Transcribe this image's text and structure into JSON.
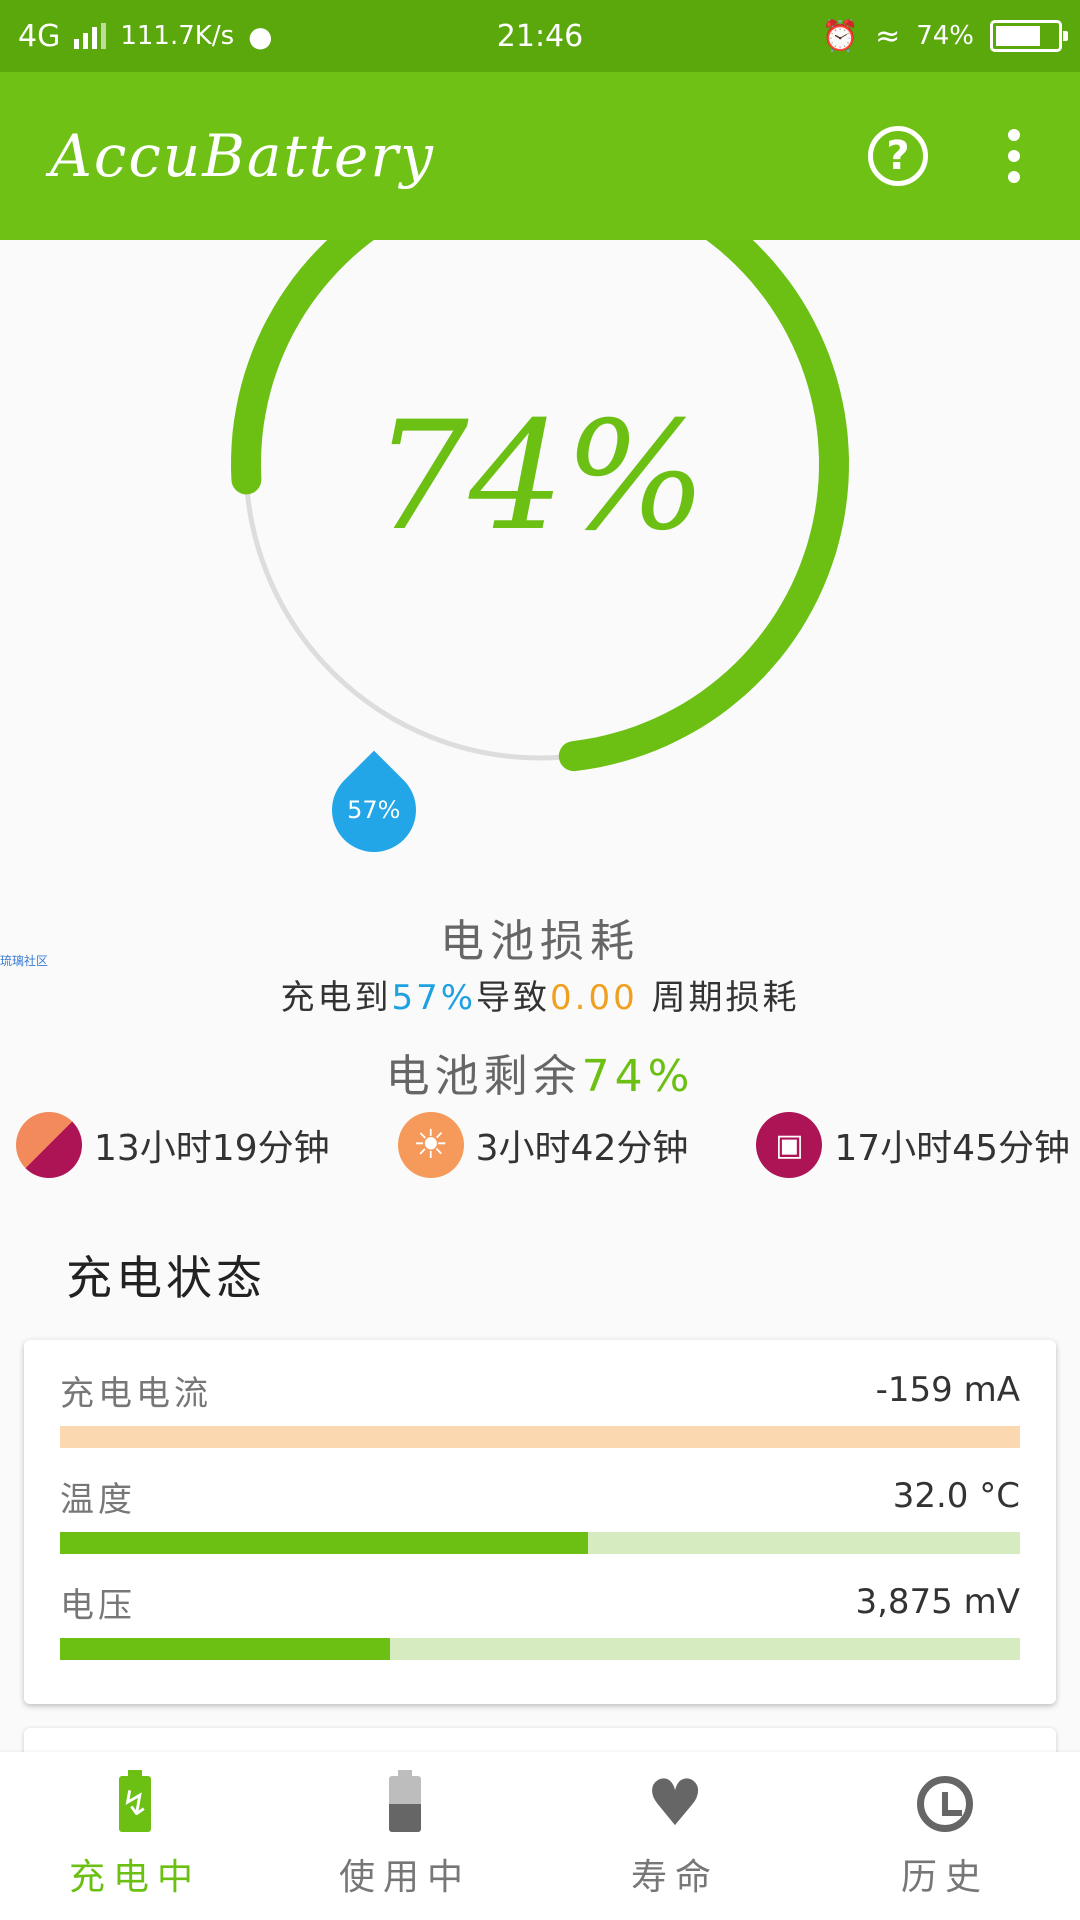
{
  "status_bar": {
    "network": "4G",
    "speed": "111.7K/s",
    "time": "21:46",
    "battery_text": "74%",
    "battery_level": 0.74
  },
  "app_bar": {
    "title": "AccuBattery",
    "help_icon": "help-circle-icon",
    "more_icon": "more-vert-icon"
  },
  "gauge": {
    "percent_text": "74%",
    "percent": 74,
    "marker_text": "57%",
    "marker_percent": 57,
    "colors": {
      "arc": "#6cc014",
      "track": "#dddddd",
      "marker": "#22a6e8"
    }
  },
  "wear": {
    "title": "电池损耗",
    "watermark": "琉璃社区",
    "line_prefix": "充电到",
    "charge_to": "57%",
    "line_mid": "导致",
    "cycles": "0.00",
    "line_suffix": "周期损耗",
    "remain_label": "电池剩余",
    "remain_value": "74%"
  },
  "estimates": [
    {
      "icon": "mixed-usage-icon",
      "text": "13小时19分钟"
    },
    {
      "icon": "screen-on-sun-icon",
      "text": "3小时42分钟"
    },
    {
      "icon": "sleep-bed-icon",
      "text": "17小时45分钟"
    }
  ],
  "charge_status": {
    "title": "充电状态",
    "metrics": [
      {
        "label": "充电电流",
        "value": "-159 mA",
        "fill": 1.0
      },
      {
        "label": "温度",
        "value": "32.0 °C",
        "fill": 0.55
      },
      {
        "label": "电压",
        "value": "3,875 mV",
        "fill": 0.344
      }
    ]
  },
  "bottom_nav": [
    {
      "label": "充电中",
      "icon": "battery-charging-icon",
      "active": true
    },
    {
      "label": "使用中",
      "icon": "battery-discharging-icon",
      "active": false
    },
    {
      "label": "寿命",
      "icon": "heart-icon",
      "active": false
    },
    {
      "label": "历史",
      "icon": "history-icon",
      "active": false
    }
  ]
}
